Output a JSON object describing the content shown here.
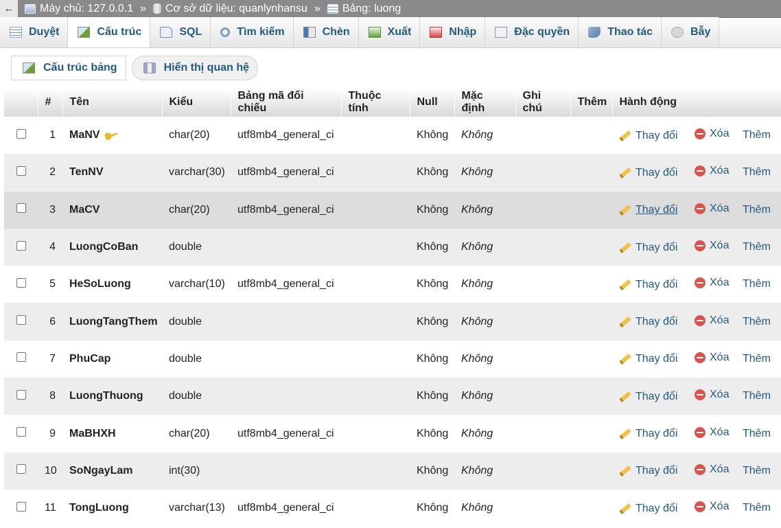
{
  "breadcrumb": {
    "back_glyph": "←",
    "server": "Máy chủ: 127.0.0.1",
    "database": "Cơ sở dữ liệu: quanlynhansu",
    "table": "Bảng: luong",
    "separator": "»"
  },
  "tabs": [
    {
      "label": "Duyệt",
      "icon": "browse-icon"
    },
    {
      "label": "Cấu trúc",
      "icon": "structure-icon",
      "active": true
    },
    {
      "label": "SQL",
      "icon": "sql-icon"
    },
    {
      "label": "Tìm kiếm",
      "icon": "search-icon"
    },
    {
      "label": "Chèn",
      "icon": "insert-icon"
    },
    {
      "label": "Xuất",
      "icon": "export-icon"
    },
    {
      "label": "Nhập",
      "icon": "import-icon"
    },
    {
      "label": "Đặc quyền",
      "icon": "privileges-icon"
    },
    {
      "label": "Thao tác",
      "icon": "operations-icon"
    },
    {
      "label": "Bẫy",
      "icon": "triggers-icon"
    }
  ],
  "subtabs": [
    {
      "label": "Cấu trúc bảng",
      "icon": "table-structure-icon"
    },
    {
      "label": "Hiển thị quan hệ",
      "icon": "relation-view-icon"
    }
  ],
  "columns": {
    "num": "#",
    "name": "Tên",
    "type": "Kiểu",
    "collation": "Bảng mã đối chiếu",
    "attributes": "Thuộc tính",
    "null": "Null",
    "default": "Mặc định",
    "comment": "Ghi chú",
    "extra": "Thêm",
    "actions": "Hành động"
  },
  "rows": [
    {
      "num": "1",
      "name": "MaNV",
      "type": "char(20)",
      "collation": "utf8mb4_general_ci",
      "attributes": "",
      "null": "Không",
      "default": "Không",
      "comment": "",
      "extra": "",
      "primary_key": true
    },
    {
      "num": "2",
      "name": "TenNV",
      "type": "varchar(30)",
      "collation": "utf8mb4_general_ci",
      "attributes": "",
      "null": "Không",
      "default": "Không",
      "comment": "",
      "extra": ""
    },
    {
      "num": "3",
      "name": "MaCV",
      "type": "char(20)",
      "collation": "utf8mb4_general_ci",
      "attributes": "",
      "null": "Không",
      "default": "Không",
      "comment": "",
      "extra": ""
    },
    {
      "num": "4",
      "name": "LuongCoBan",
      "type": "double",
      "collation": "",
      "attributes": "",
      "null": "Không",
      "default": "Không",
      "comment": "",
      "extra": ""
    },
    {
      "num": "5",
      "name": "HeSoLuong",
      "type": "varchar(10)",
      "collation": "utf8mb4_general_ci",
      "attributes": "",
      "null": "Không",
      "default": "Không",
      "comment": "",
      "extra": ""
    },
    {
      "num": "6",
      "name": "LuongTangThem",
      "type": "double",
      "collation": "",
      "attributes": "",
      "null": "Không",
      "default": "Không",
      "comment": "",
      "extra": ""
    },
    {
      "num": "7",
      "name": "PhuCap",
      "type": "double",
      "collation": "",
      "attributes": "",
      "null": "Không",
      "default": "Không",
      "comment": "",
      "extra": ""
    },
    {
      "num": "8",
      "name": "LuongThuong",
      "type": "double",
      "collation": "",
      "attributes": "",
      "null": "Không",
      "default": "Không",
      "comment": "",
      "extra": ""
    },
    {
      "num": "9",
      "name": "MaBHXH",
      "type": "char(20)",
      "collation": "utf8mb4_general_ci",
      "attributes": "",
      "null": "Không",
      "default": "Không",
      "comment": "",
      "extra": ""
    },
    {
      "num": "10",
      "name": "SoNgayLam",
      "type": "int(30)",
      "collation": "",
      "attributes": "",
      "null": "Không",
      "default": "Không",
      "comment": "",
      "extra": ""
    },
    {
      "num": "11",
      "name": "TongLuong",
      "type": "varchar(13)",
      "collation": "utf8mb4_general_ci",
      "attributes": "",
      "null": "Không",
      "default": "Không",
      "comment": "",
      "extra": ""
    }
  ],
  "actions": {
    "change": "Thay đổi",
    "drop": "Xóa",
    "more": "Thêm"
  },
  "hover_row_index": 2
}
